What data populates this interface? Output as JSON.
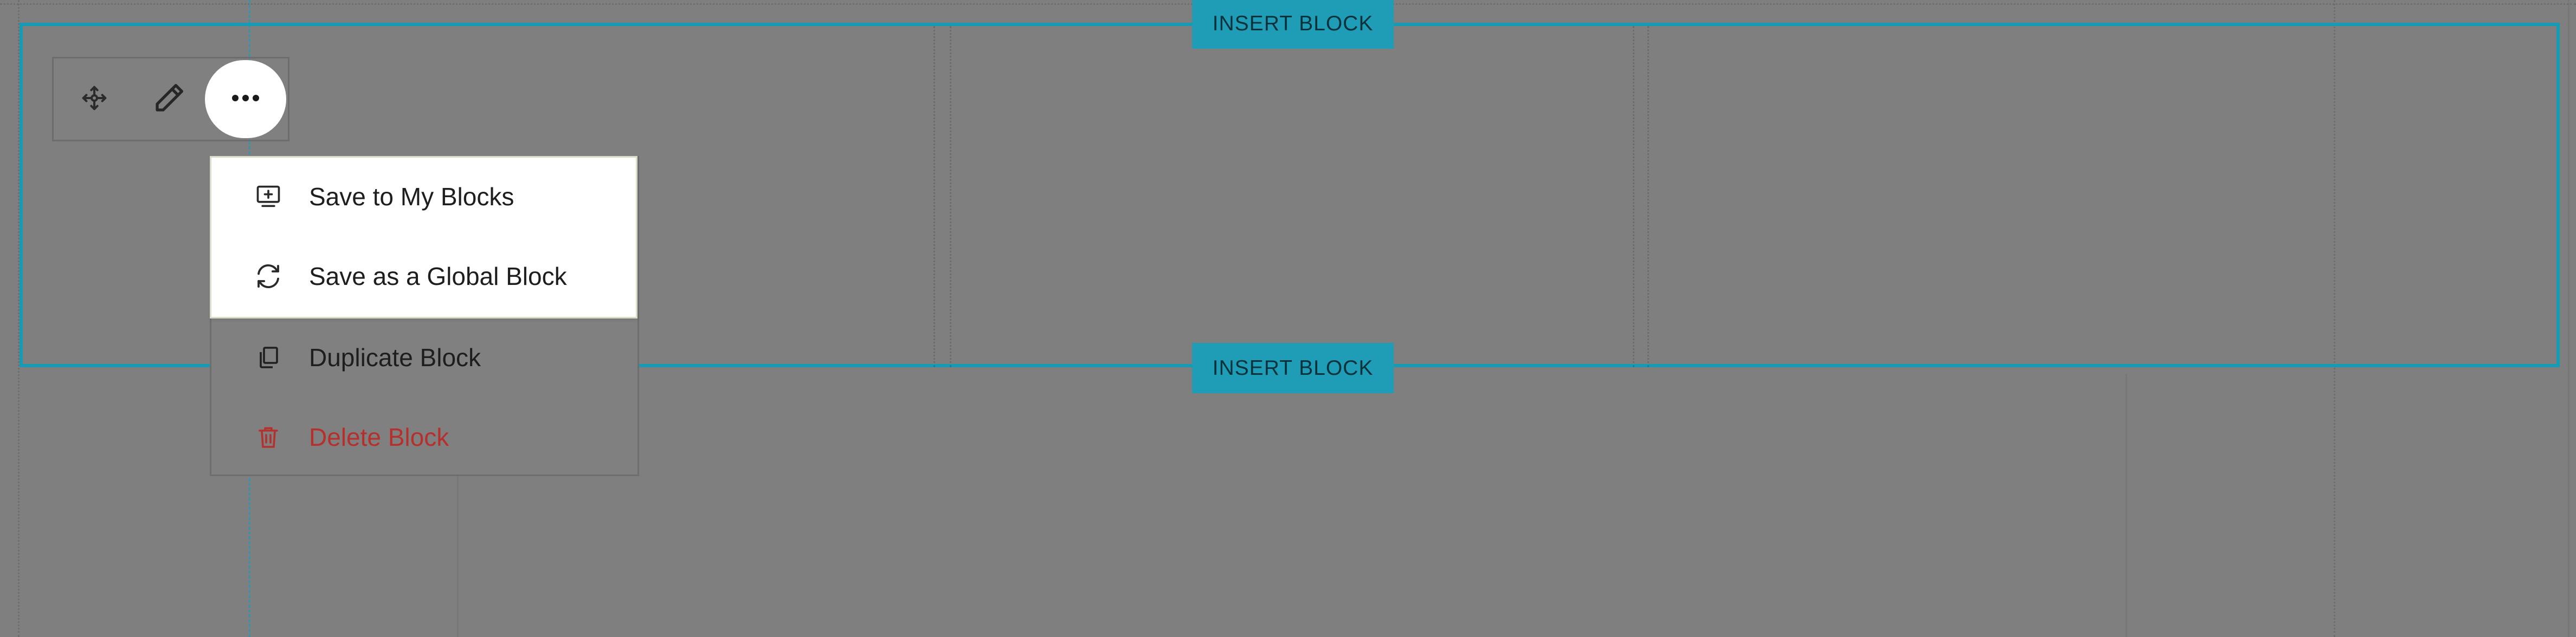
{
  "insert_buttons": {
    "top_label": "INSERT BLOCK",
    "bottom_label": "INSERT BLOCK"
  },
  "toolbar": {
    "icons": {
      "move": "move-icon",
      "edit": "pencil-icon",
      "more": "more-horizontal-icon"
    }
  },
  "menu": {
    "items": [
      {
        "label": "Save to My Blocks",
        "icon": "save-to-library-icon"
      },
      {
        "label": "Save as a Global Block",
        "icon": "sync-icon"
      },
      {
        "label": "Duplicate Block",
        "icon": "duplicate-icon"
      },
      {
        "label": "Delete Block",
        "icon": "trash-icon"
      }
    ]
  },
  "colors": {
    "accent": "#169bb4",
    "overlay": "#7f7f7f",
    "danger": "#b5302c",
    "menu_bg": "#ffffff"
  }
}
